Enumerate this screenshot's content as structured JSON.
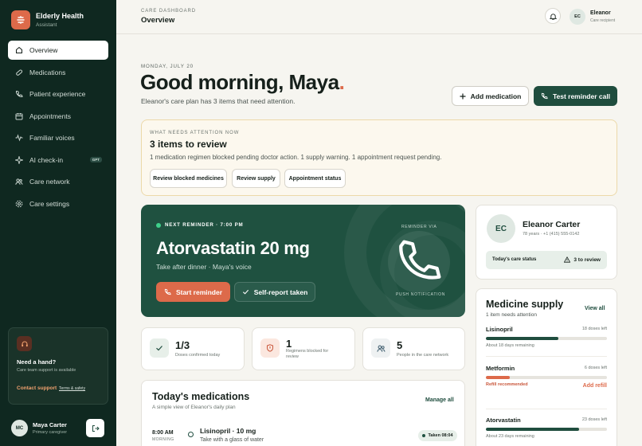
{
  "brand": {
    "name": "Elderly Health",
    "sub": "Assistant"
  },
  "nav": {
    "items": [
      {
        "label": "Overview"
      },
      {
        "label": "Medications"
      },
      {
        "label": "Patient experience"
      },
      {
        "label": "Appointments"
      },
      {
        "label": "Familiar voices"
      },
      {
        "label": "AI check-in",
        "badge": "GPT"
      },
      {
        "label": "Care network"
      },
      {
        "label": "Care settings"
      }
    ]
  },
  "help": {
    "title": "Need a hand?",
    "text": "Care team support is available",
    "link": "Contact support",
    "link2": "Terms & safety"
  },
  "user": {
    "initials": "MC",
    "name": "Maya Carter",
    "role": "Primary caregiver"
  },
  "topbar": {
    "crumb": "CARE DASHBOARD",
    "title": "Overview",
    "initials": "EC",
    "name": "Eleanor",
    "sub": "Care recipient"
  },
  "greeting": {
    "date": "MONDAY, JULY 20",
    "text": "Good morning, Maya",
    "dot": ".",
    "plan": "Eleanor's care plan has 3 items that need attention."
  },
  "actions": {
    "add": "Add medication",
    "test": "Test reminder call"
  },
  "attention": {
    "eyebrow": "WHAT NEEDS ATTENTION NOW",
    "title": "3 items to review",
    "sub": "1 medication regimen blocked pending doctor action. 1 supply warning. 1 appointment request pending.",
    "chips": [
      "Review blocked medicines",
      "Review supply",
      "Appointment status"
    ]
  },
  "reminder": {
    "eyebrow": "NEXT REMINDER · 7:00 PM",
    "drug": "Atorvastatin 20 mg",
    "note": "Take after dinner · Maya's voice",
    "start": "Start reminder",
    "self": "Self-report taken",
    "via": "REMINDER VIA",
    "channel": "PUSH NOTIFICATION"
  },
  "stats": [
    {
      "value": "1/3",
      "label": "Doses confirmed today"
    },
    {
      "value": "1",
      "label": "Regimens blocked for review"
    },
    {
      "value": "5",
      "label": "People in the care network"
    }
  ],
  "today": {
    "title": "Today's medications",
    "sub": "A simple view of Eleanor's daily plan",
    "manage": "Manage all",
    "items": [
      {
        "time": "8:00 AM",
        "period": "MORNING",
        "name": "Lisinopril · 10 mg",
        "note": "Take with a glass of water",
        "status": "Taken 08:04"
      }
    ]
  },
  "profile": {
    "initials": "EC",
    "name": "Eleanor Carter",
    "meta": "78 years · +1 (415) 555-0142",
    "status_label": "Today's care status",
    "status_value": "3 to review"
  },
  "supply": {
    "title": "Medicine supply",
    "sub": "1 item needs attention",
    "view": "View all",
    "items": [
      {
        "name": "Lisinopril",
        "doses": "18 doses left",
        "foot": "About 18 days remaining",
        "level": 0.6,
        "color": "#1f4d3e"
      },
      {
        "name": "Metformin",
        "doses": "6 doses left",
        "foot": "Refill recommended",
        "action": "Add refill",
        "level": 0.2,
        "color": "#dd6a4a"
      },
      {
        "name": "Atorvastatin",
        "doses": "23 doses left",
        "foot": "About 23 days remaining",
        "level": 0.77,
        "color": "#1f4d3e"
      }
    ]
  }
}
